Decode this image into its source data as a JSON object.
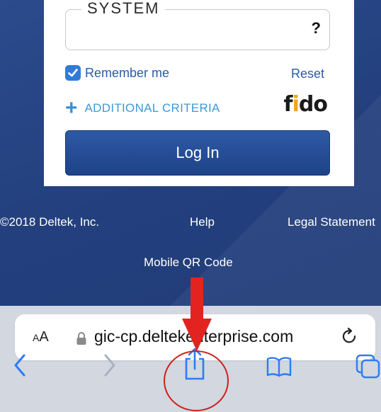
{
  "login_card": {
    "system_legend": "SYSTEM",
    "system_help": "?",
    "remember_label": "Remember me",
    "remember_checked": true,
    "reset_label": "Reset",
    "criteria_plus": "+",
    "criteria_label": "ADDITIONAL CRITERIA",
    "fido_f": "f",
    "fido_i": "i",
    "fido_do": "do",
    "login_label": "Log In"
  },
  "footer": {
    "copyright": "©2018 Deltek, Inc.",
    "help": "Help",
    "legal": "Legal Statement",
    "mobile_qr": "Mobile QR Code"
  },
  "browser": {
    "aa_small": "A",
    "aa_large": "A",
    "url": "gic-cp.deltekenterprise.com"
  },
  "colors": {
    "page_bg": "#21407e",
    "login_button": "#2e5aa5",
    "link": "#2b5aa6",
    "criteria": "#3a9ad8",
    "fido_accent": "#f2a41c",
    "annotation": "#d0201c",
    "safari_blue": "#2f7bf6",
    "toolbar_bg": "#d2d7e0"
  }
}
